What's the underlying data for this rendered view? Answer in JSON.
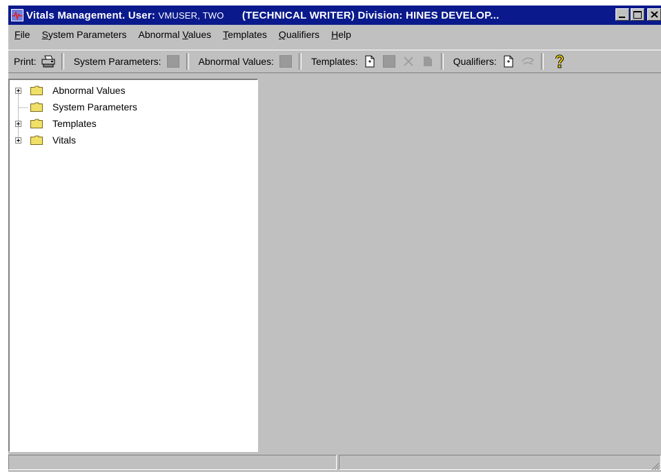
{
  "window": {
    "title_prefix": "Vitals Management. User: ",
    "user": "VMUSER, TWO",
    "title_suffix": "(TECHNICAL WRITER) Division: HINES DEVELOP..."
  },
  "menu": [
    {
      "mnemonic": "F",
      "rest": "ile"
    },
    {
      "mnemonic": "S",
      "rest": "ystem Parameters"
    },
    {
      "pre": "Abnormal ",
      "mnemonic": "V",
      "rest": "alues"
    },
    {
      "mnemonic": "T",
      "rest": "emplates"
    },
    {
      "mnemonic": "Q",
      "rest": "ualifiers"
    },
    {
      "mnemonic": "H",
      "rest": "elp"
    }
  ],
  "toolbar": {
    "print_label": "Print:",
    "system_parameters_label": "System Parameters:",
    "abnormal_values_label": "Abnormal Values:",
    "templates_label": "Templates:",
    "qualifiers_label": "Qualifiers:"
  },
  "tree": {
    "items": [
      {
        "label": "Abnormal Values",
        "expandable": true
      },
      {
        "label": "System Parameters",
        "expandable": false
      },
      {
        "label": "Templates",
        "expandable": true
      },
      {
        "label": "Vitals",
        "expandable": true
      }
    ]
  },
  "colors": {
    "titlebar": "#0a1a8c",
    "face": "#c0c0c0",
    "folder": "#f0e068"
  },
  "icons": [
    "app-icon",
    "minimize-icon",
    "maximize-icon",
    "close-icon",
    "printer-icon",
    "new-document-icon",
    "delete-icon",
    "save-icon",
    "edit-icon",
    "help-icon",
    "folder-icon",
    "expand-icon"
  ]
}
